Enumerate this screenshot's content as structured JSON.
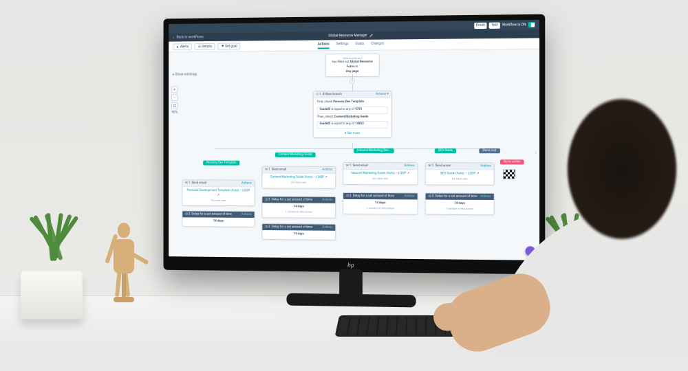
{
  "topbar": {
    "right_label": "Workflow is ON",
    "enroll": "Enroll",
    "test": "Test"
  },
  "subbar": {
    "back": "Back to workflows",
    "title": "Global Resource Manager"
  },
  "toolbar": {
    "alerts": "Alerts",
    "details": "Details",
    "set_goal": "Set goal"
  },
  "tabs": [
    "Actions",
    "Settings",
    "Goals",
    "Changes"
  ],
  "minimap": "Show minimap",
  "zoom_pct": "90%",
  "enrollment": {
    "caption": "View enrollment",
    "line1": "has filled out",
    "form": "Global Resource Form",
    "line2": "on",
    "line3": "Any page"
  },
  "branch_node": {
    "header": "1. If/then branch",
    "action": "Actions",
    "l1a": "First, check",
    "l1b": "Persona Dev Template",
    "l2a": "GuideID",
    "l2b": "is equal to any of",
    "l2c": "9781",
    "l3a": "Then, check",
    "l3b": "Content Marketing Guide",
    "l4a": "GuideID",
    "l4b": "is equal to any of",
    "l4c": "14822",
    "more": "See more"
  },
  "branches": {
    "b1": "Persona Dev Template",
    "b2": "Content Marketing Guide",
    "b3": "Inbound Marketing Res…",
    "b4": "SEO Guide",
    "none": "None met",
    "goto": "Go to action"
  },
  "step": {
    "send_email": "Send email",
    "delay": "Delay for a set amount of time",
    "actions": "Actions",
    "days14": "14 days",
    "content": "1 contact in this action"
  },
  "emails": {
    "e1": {
      "name": "Personal Development Template (Auto) – LOOP",
      "rate": "0% click rate"
    },
    "e2": {
      "name": "Content Marketing Guide (Auto) – LOOP",
      "rate": "0% click rate"
    },
    "e3": {
      "name": "Inbound Marketing Guide (Auto) – LOOP",
      "rate": "0% click rate"
    },
    "e4": {
      "name": "SEO Guide (Auto) – LOOP",
      "rate": "0% click rate"
    }
  },
  "monitor_brand": "hp"
}
